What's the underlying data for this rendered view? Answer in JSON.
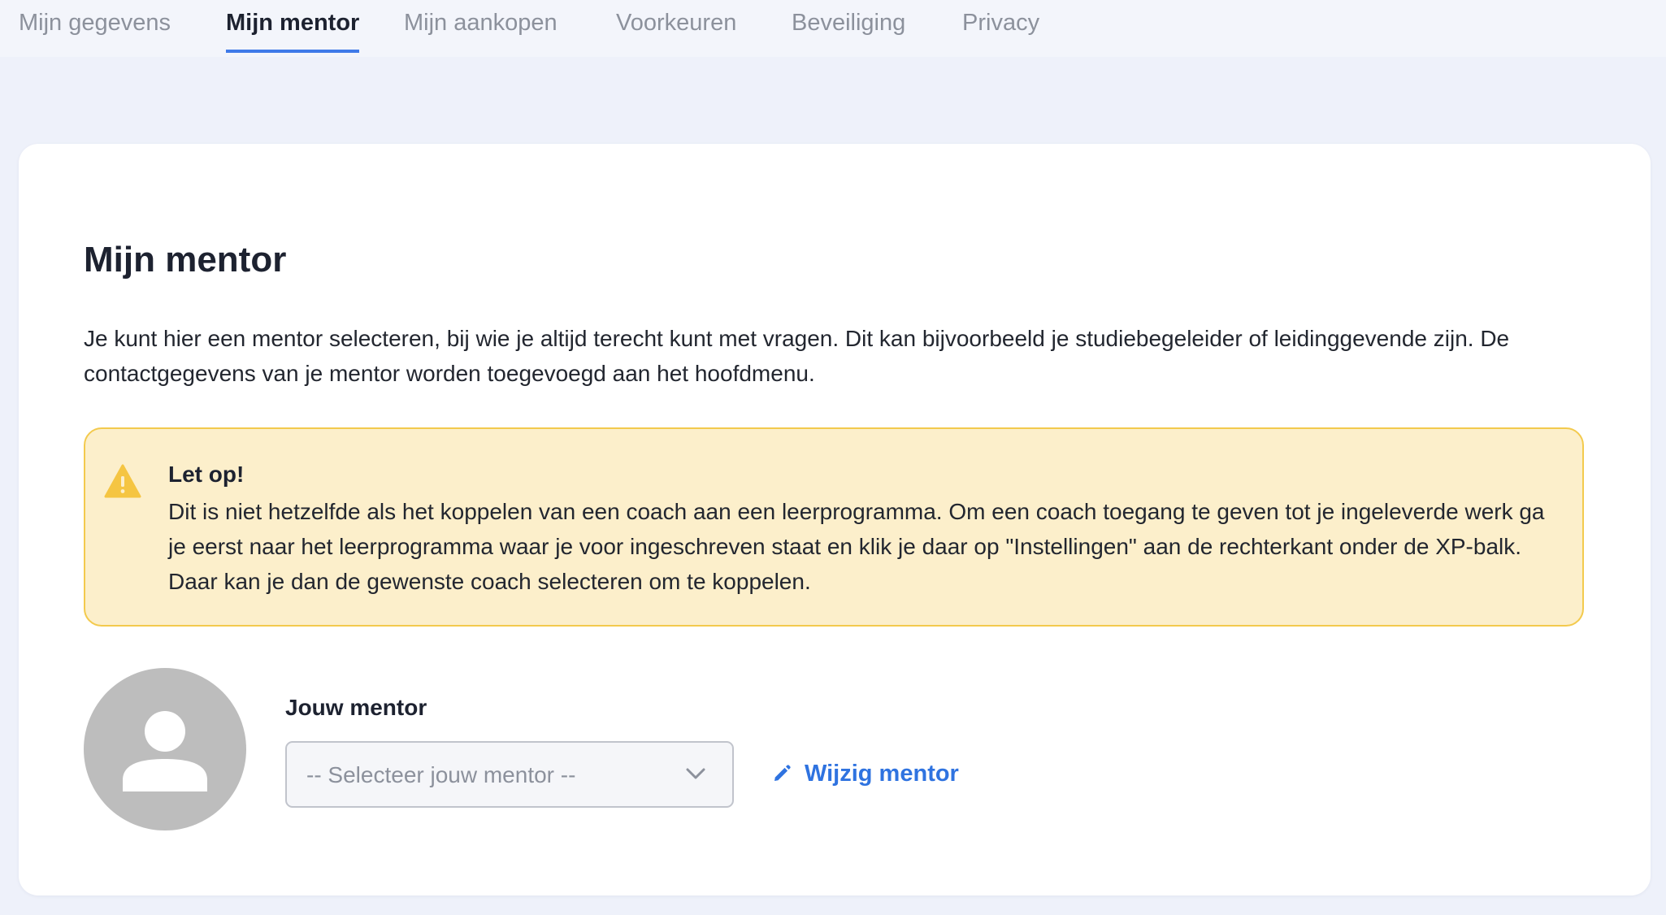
{
  "tabs": [
    {
      "label": "Mijn gegevens",
      "active": false
    },
    {
      "label": "Mijn mentor",
      "active": true
    },
    {
      "label": "Mijn aankopen",
      "active": false
    },
    {
      "label": "Voorkeuren",
      "active": false
    },
    {
      "label": "Beveiliging",
      "active": false
    },
    {
      "label": "Privacy",
      "active": false
    }
  ],
  "content": {
    "title": "Mijn mentor",
    "intro": "Je kunt hier een mentor selecteren, bij wie je altijd terecht kunt met vragen. Dit kan bijvoorbeeld je studiebegeleider of leidinggevende zijn. De contactgegevens van je mentor worden toegevoegd aan het hoofdmenu.",
    "alert": {
      "icon": "warning-icon",
      "title": "Let op!",
      "text": "Dit is niet hetzelfde als het koppelen van een coach aan een leerprogramma. Om een coach toegang te geven tot je ingeleverde werk ga je eerst naar het leerprogramma waar je voor ingeschreven staat en klik je daar op \"Instellingen\" aan de rechterkant onder de XP-balk. Daar kan je dan de gewenste coach selecteren om te koppelen."
    },
    "mentor": {
      "avatar_icon": "user-placeholder-icon",
      "label": "Jouw mentor",
      "select_value": "-- Selecteer jouw mentor --",
      "edit_icon": "pencil-icon",
      "edit_label": "Wijzig mentor"
    }
  },
  "colors": {
    "page_background": "#eef1fa",
    "card_background": "#ffffff",
    "accent": "#3f7ae8",
    "link": "#2f73e0",
    "alert_background": "#fcefcb",
    "alert_border": "#f3ca4d",
    "warning_icon": "#f5c542",
    "avatar": "#bdbdbd"
  }
}
